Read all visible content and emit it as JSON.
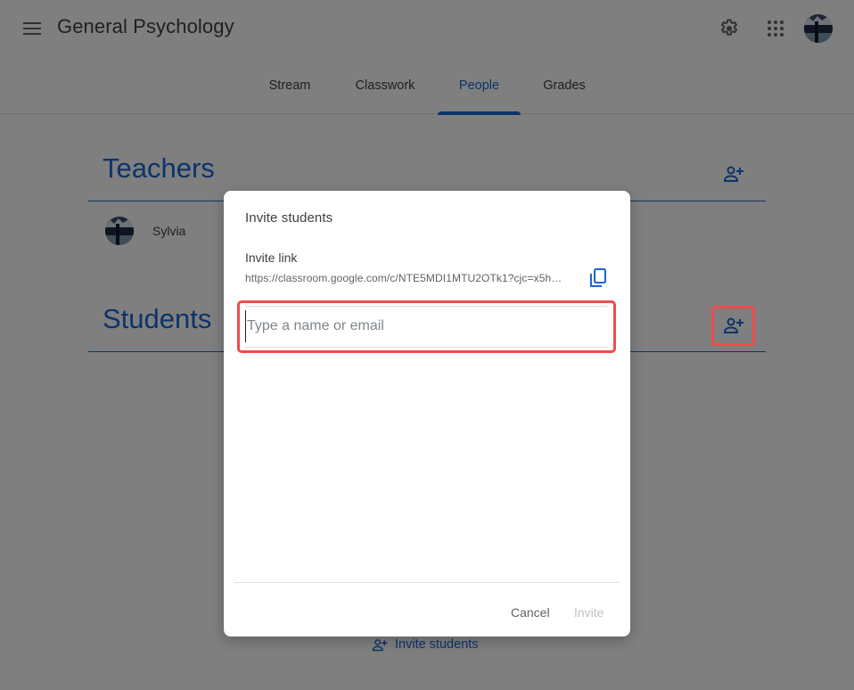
{
  "header": {
    "title": "General Psychology",
    "icons": {
      "menu": "hamburger-menu-icon",
      "settings": "gear-icon",
      "apps": "apps-grid-icon",
      "account": "account-avatar"
    }
  },
  "tabs": [
    {
      "label": "Stream",
      "active": false
    },
    {
      "label": "Classwork",
      "active": false
    },
    {
      "label": "People",
      "active": true
    },
    {
      "label": "Grades",
      "active": false
    }
  ],
  "people": {
    "teachers_title": "Teachers",
    "students_title": "Students",
    "teachers": [
      {
        "name": "Sylvia"
      }
    ],
    "invite_students_link": "Invite students"
  },
  "dialog": {
    "title": "Invite students",
    "invite_link_label": "Invite link",
    "invite_link_url": "https://classroom.google.com/c/NTE5MDI1MTU2OTk1?cjc=x5h…",
    "input_placeholder": "Type a name or email",
    "input_value": "",
    "cancel_label": "Cancel",
    "invite_label": "Invite"
  },
  "colors": {
    "accent": "#1967d2",
    "highlight": "#f04b4b",
    "disabled": "#bdc1c6"
  }
}
